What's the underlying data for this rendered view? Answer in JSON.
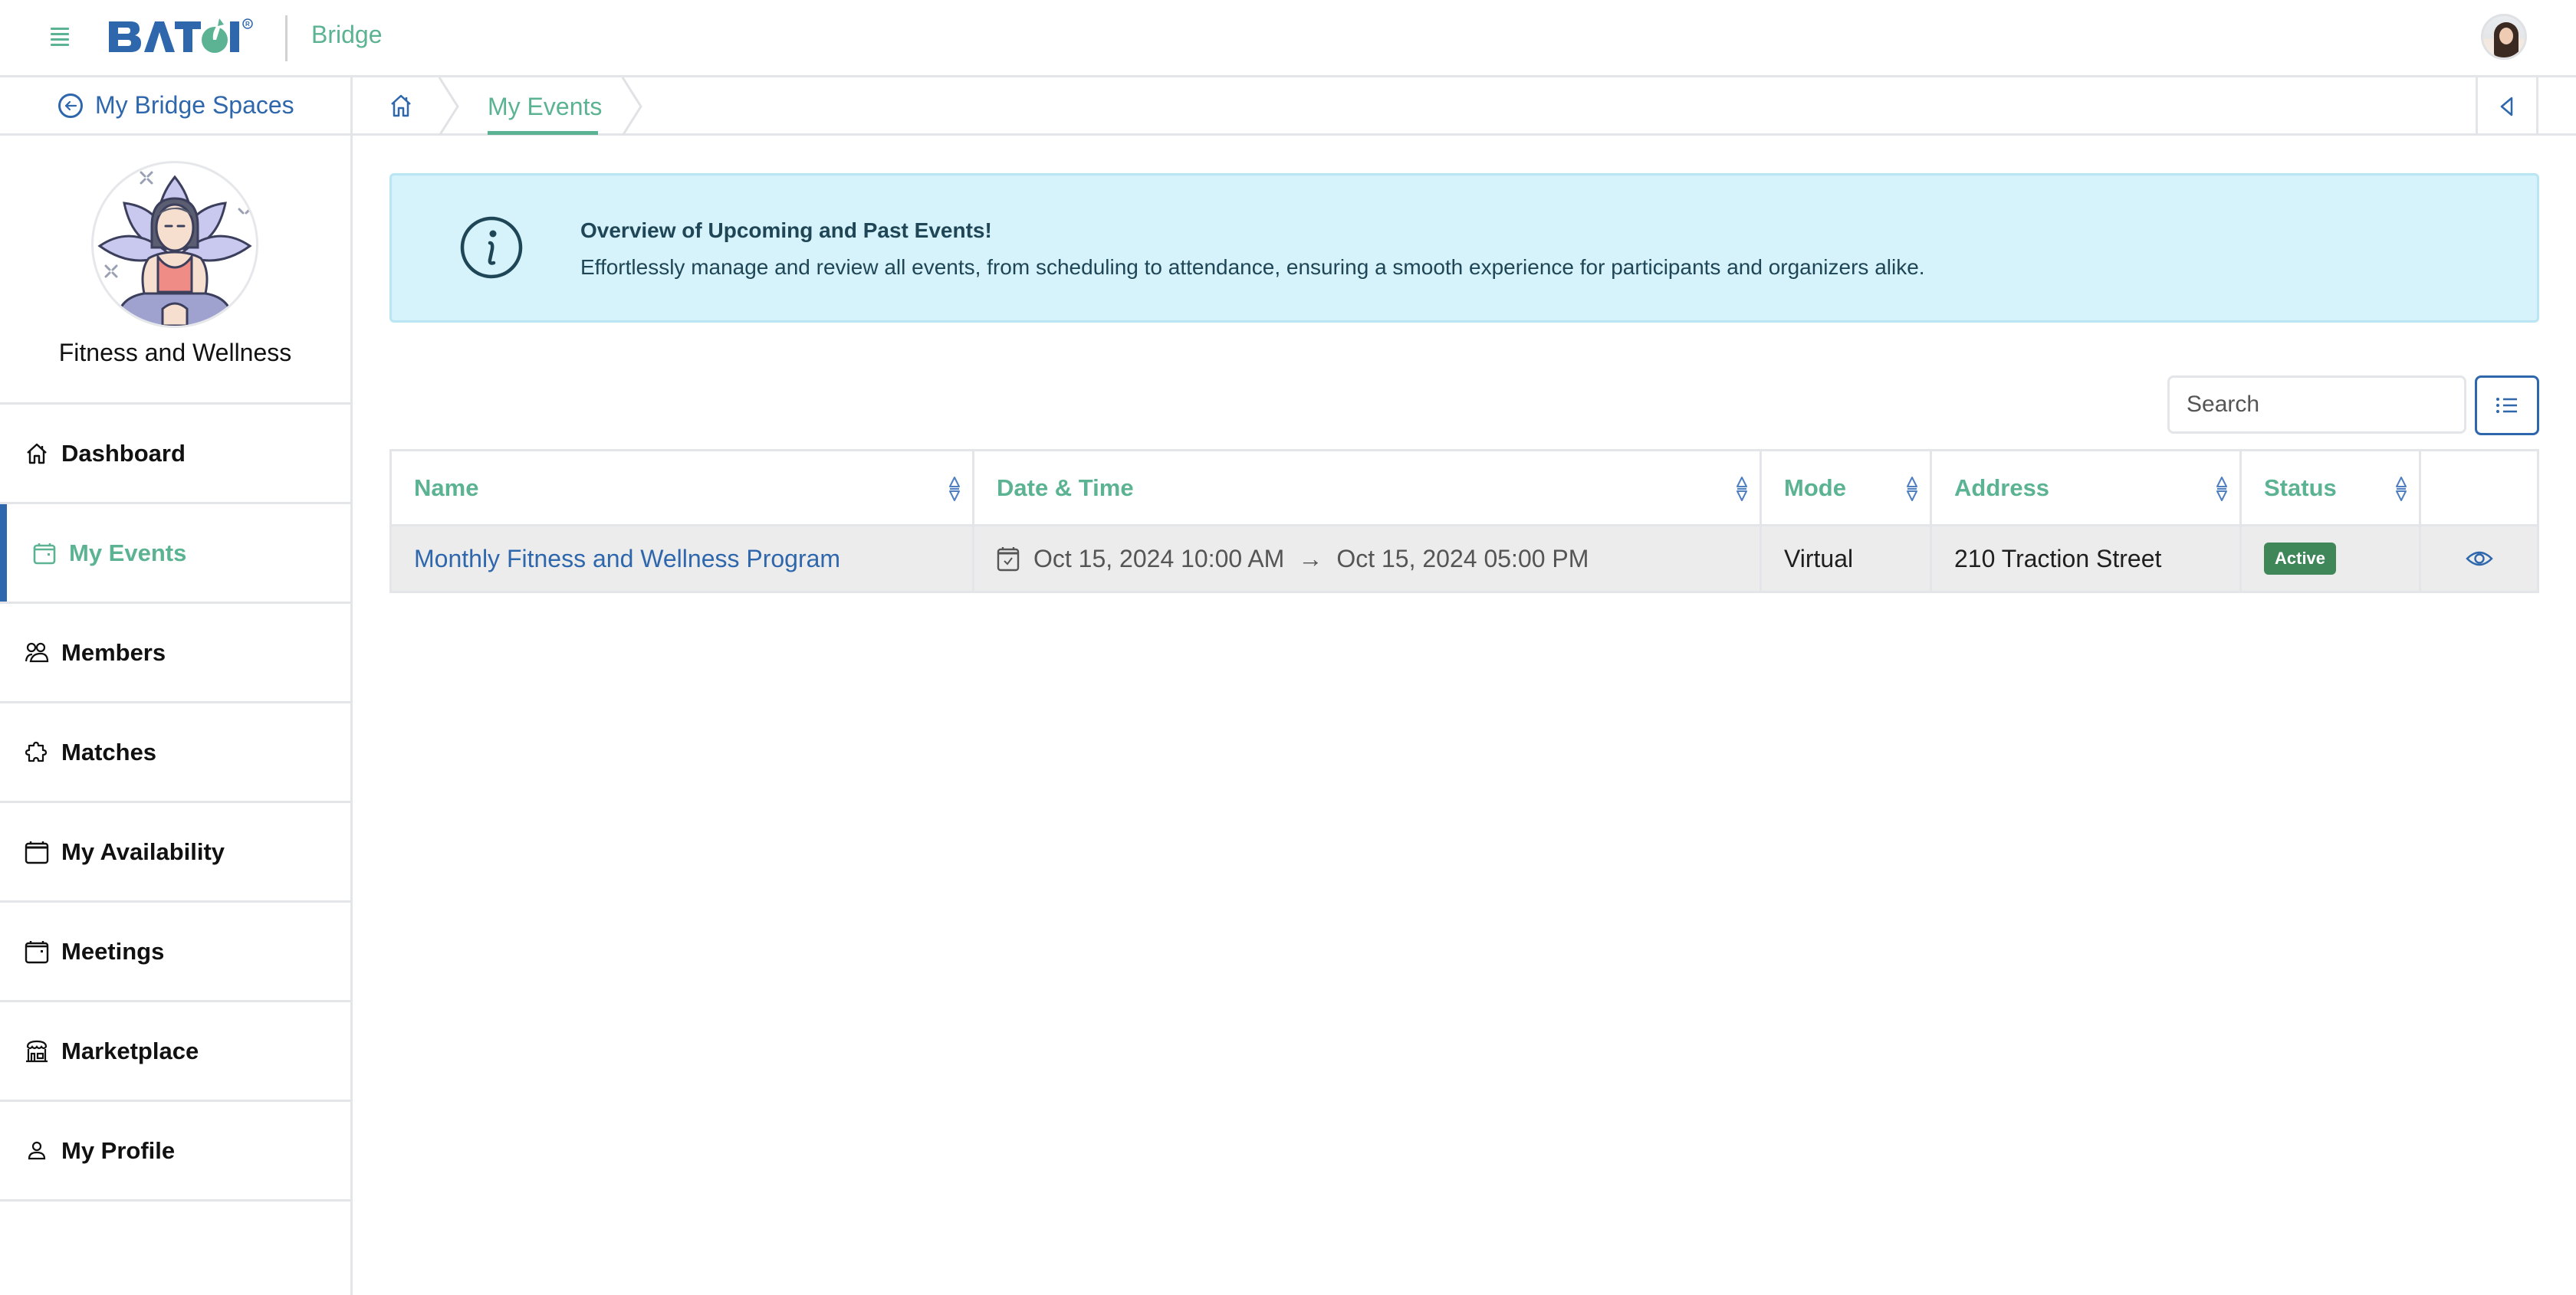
{
  "header": {
    "logo_text": "BATOI",
    "app_name": "Bridge",
    "menu_icon": "hamburger-icon",
    "user_avatar": "user-avatar-photo"
  },
  "subheader": {
    "back_label": "My Bridge Spaces",
    "breadcrumb": {
      "home_icon": "home-icon",
      "current": "My Events"
    },
    "collapse_icon": "triangle-left-icon"
  },
  "sidebar": {
    "space_name": "Fitness and Wellness",
    "active_item": "My Events",
    "items": [
      {
        "label": "Dashboard",
        "icon": "home-icon"
      },
      {
        "label": "My Events",
        "icon": "calendar-icon"
      },
      {
        "label": "Members",
        "icon": "users-icon"
      },
      {
        "label": "Matches",
        "icon": "puzzle-icon"
      },
      {
        "label": "My Availability",
        "icon": "calendar-blank-icon"
      },
      {
        "label": "Meetings",
        "icon": "calendar-icon"
      },
      {
        "label": "Marketplace",
        "icon": "store-icon"
      },
      {
        "label": "My Profile",
        "icon": "user-icon"
      }
    ]
  },
  "banner": {
    "icon": "info-icon",
    "title": "Overview of Upcoming and Past Events!",
    "text": "Effortlessly manage and review all events, from scheduling to attendance, ensuring a smooth experience for participants and organizers alike."
  },
  "toolbar": {
    "search_placeholder": "Search",
    "search_value": "",
    "filter_icon": "list-icon"
  },
  "table": {
    "columns": [
      "Name",
      "Date & Time",
      "Mode",
      "Address",
      "Status",
      ""
    ],
    "rows": [
      {
        "name": "Monthly Fitness and Wellness Program",
        "start": "Oct 15, 2024 10:00 AM",
        "arrow": "→",
        "end": "Oct 15, 2024 05:00 PM",
        "mode": "Virtual",
        "address": "210 Traction Street",
        "status": "Active",
        "action_icon": "eye-icon"
      }
    ]
  },
  "colors": {
    "brand_blue": "#2f67ad",
    "brand_green": "#5bb393",
    "banner_bg": "#d6f2fa",
    "status_active": "#3f8659",
    "row_bg": "#ececec"
  }
}
